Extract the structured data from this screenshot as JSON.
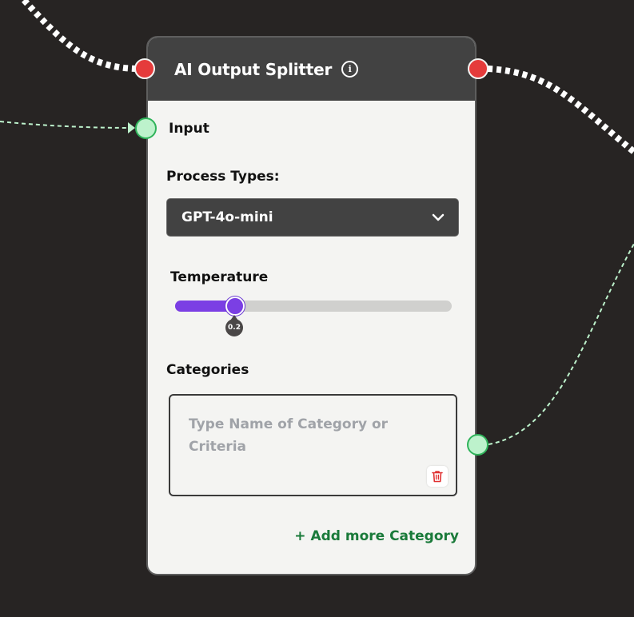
{
  "node": {
    "title": "AI Output Splitter",
    "input_label": "Input",
    "process_types_label": "Process Types:",
    "process_selected": "GPT-4o-mini",
    "temperature_label": "Temperature",
    "temperature_value": "0.2",
    "temperature_fraction": 0.2,
    "categories_label": "Categories",
    "categories_placeholder": "Type Name of Category or Criteria",
    "add_more_label": "+ Add more Category"
  },
  "colors": {
    "canvas_bg": "#272423",
    "header_bg": "#424242",
    "node_bg": "#f4f4f2",
    "accent_purple": "#7b3fe4",
    "port_red": "#e53b3b",
    "port_green": "#bdf2cc",
    "link_green": "#1a7a3a",
    "delete_red": "#e03030"
  },
  "icons": {
    "info": "info-icon",
    "dropdown": "chevron-down-icon",
    "delete": "trash-icon"
  }
}
